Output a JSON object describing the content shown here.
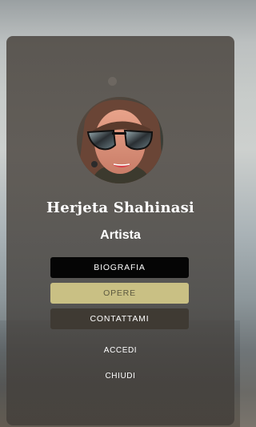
{
  "profile": {
    "name": "Herjeta Shahinasi",
    "role": "Artista"
  },
  "menu": {
    "biografia": "BIOGRAFIA",
    "opere": "OPERE",
    "contattami": "CONTATTAMI",
    "accedi": "ACCEDI",
    "chiudi": "CHIUDI"
  },
  "colors": {
    "accent": "#c9c084",
    "dark_button": "#050505",
    "secondary_button": "#3f3a33"
  }
}
